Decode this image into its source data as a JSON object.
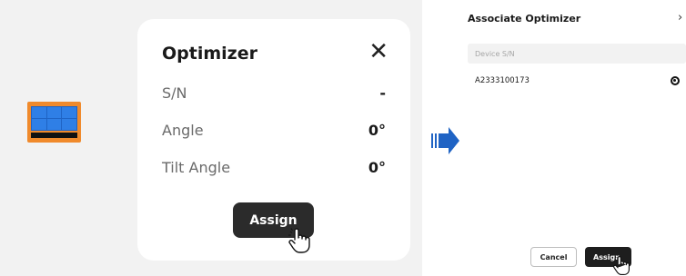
{
  "left_panel": {
    "card": {
      "title": "Optimizer",
      "close_glyph": "✕",
      "rows": [
        {
          "label": "S/N",
          "value": "-"
        },
        {
          "label": "Angle",
          "value": "0°"
        },
        {
          "label": "Tilt Angle",
          "value": "0°"
        }
      ],
      "assign_label": "Assign"
    },
    "solar_panel_icon": "solar-panel-icon",
    "cursor_icon": "hand-pointer-icon"
  },
  "arrow_icon": "right-arrow-icon",
  "right_panel": {
    "title": "Associate Optimizer",
    "close_glyph": "›",
    "search_placeholder": "Device S/N",
    "devices": [
      {
        "serial": "A2333100173",
        "selected": true
      }
    ],
    "cancel_label": "Cancel",
    "assign_label": "Assign"
  },
  "colors": {
    "panel_frame": "#f08a2c",
    "panel_cells": "#1f63c4",
    "arrow": "#1f63c4",
    "button_dark": "#2b2b2b"
  }
}
